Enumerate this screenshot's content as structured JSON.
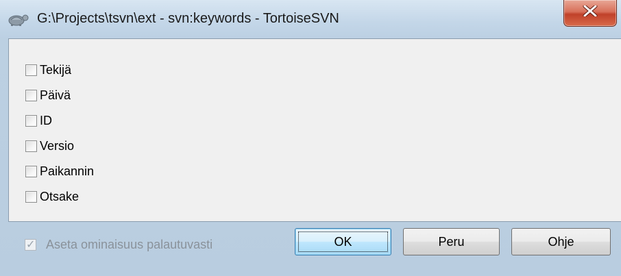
{
  "window": {
    "title": "G:\\Projects\\tsvn\\ext - svn:keywords - TortoiseSVN",
    "close_label": "x"
  },
  "keywords": [
    {
      "label": "Tekijä",
      "checked": false
    },
    {
      "label": "Päivä",
      "checked": false
    },
    {
      "label": "ID",
      "checked": false
    },
    {
      "label": "Versio",
      "checked": false
    },
    {
      "label": "Paikannin",
      "checked": false
    },
    {
      "label": "Otsake",
      "checked": false
    }
  ],
  "footer": {
    "recursive_label": "Aseta ominaisuus palautuvasti",
    "recursive_checked": true,
    "recursive_enabled": false
  },
  "buttons": {
    "ok": "OK",
    "cancel": "Peru",
    "help": "Ohje"
  }
}
